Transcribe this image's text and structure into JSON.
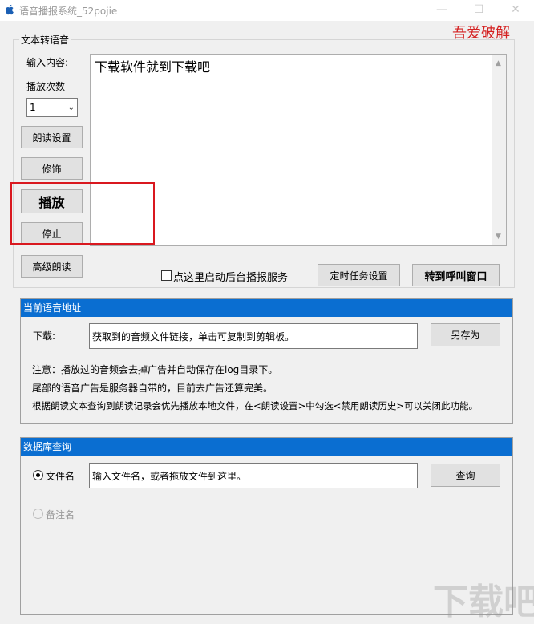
{
  "window": {
    "title": "语音播报系统_52pojie",
    "min_glyph": "—",
    "max_glyph": "☐",
    "close_glyph": "✕"
  },
  "watermark_top": "吾爱破解",
  "tts_group": {
    "label": "文本转语音",
    "input_label": "输入内容:",
    "input_text": "下载软件就到下载吧",
    "play_count_label": "播放次数",
    "play_count_value": "1",
    "read_settings_button": "朗读设置",
    "decorate_button": "修饰",
    "play_button": "播放",
    "stop_button": "停止",
    "advanced_read_button": "高级朗读",
    "background_service_checkbox": "点这里启动后台播报服务",
    "background_service_checked": false,
    "scheduled_task_button": "定时任务设置",
    "call_window_button": "转到呼叫窗口"
  },
  "voice_address_panel": {
    "header": "当前语音地址",
    "download_label": "下载:",
    "download_value": "获取到的音频文件链接，单击可复制到剪辑板。",
    "save_as_button": "另存为",
    "notes": [
      "注意：播放过的音频会去掉广告并自动保存在log目录下。",
      "尾部的语音广告是服务器自带的，目前去广告还算完美。",
      "根据朗读文本查询到朗读记录会优先播放本地文件，在<朗读设置>中勾选<禁用朗读历史>可以关闭此功能。"
    ]
  },
  "db_query_panel": {
    "header": "数据库查询",
    "radio_filename_label": "文件名",
    "radio_filename_selected": true,
    "filename_placeholder": "输入文件名，或者拖放文件到这里。",
    "query_button": "查询",
    "radio_remark_label": "备注名",
    "radio_remark_enabled": false
  },
  "watermark_bottom": "下载吧",
  "colors": {
    "highlight_box": "#d9181f",
    "panel_header": "#0a6ed1",
    "watermark_red": "#d42020"
  }
}
